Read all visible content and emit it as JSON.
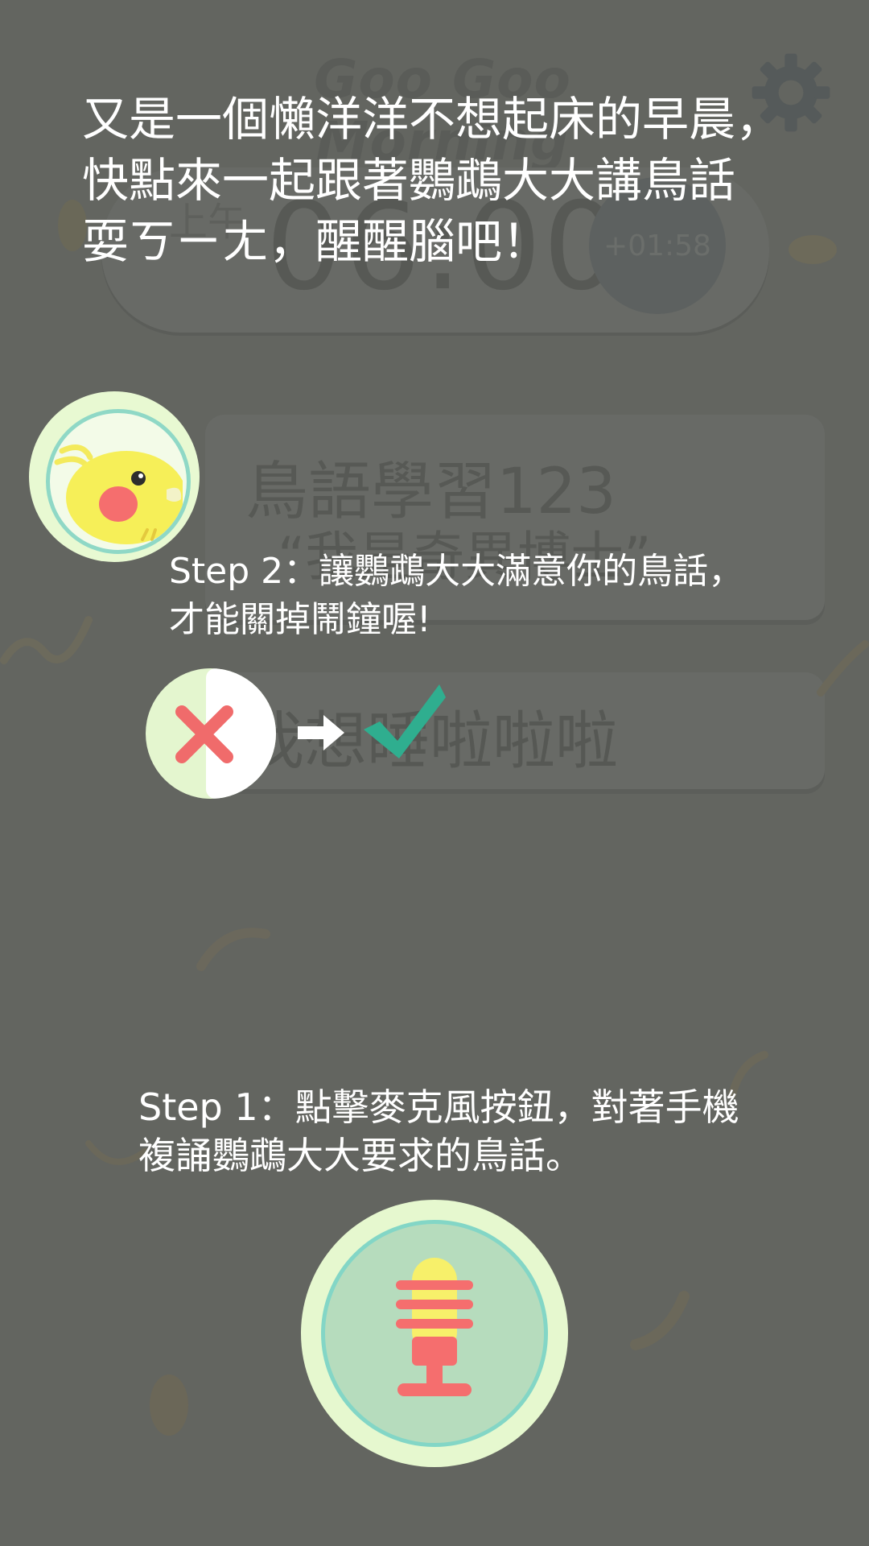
{
  "background_app": {
    "title": "Goo Goo Morning",
    "alarm": {
      "ampm": "上午",
      "time": "06:00",
      "countdown": "+01:58"
    },
    "phrase_card": {
      "title": "鳥語學習123",
      "subtitle": "“我是奇異博士”"
    },
    "answer_card": {
      "text": "我想睡啦啦啦"
    }
  },
  "overlay": {
    "intro_lines": [
      "又是一個懶洋洋不想起床的早晨，",
      "快點來一起跟著鸚鵡大大講鳥話",
      "耍ㄎㄧㄤ，醒醒腦吧！"
    ],
    "step2_lines": [
      "Step 2：讓鸚鵡大大滿意你的鳥話，",
      "才能關掉鬧鐘喔!"
    ],
    "step1_lines": [
      "Step 1：點擊麥克風按鈕，對著手機",
      "複誦鸚鵡大大要求的鳥話。"
    ]
  },
  "icons": {
    "settings": "gear-icon",
    "avatar": "parrot-icon",
    "wrong": "x-mark-icon",
    "arrow": "right-arrow-icon",
    "correct": "check-icon",
    "record": "microphone-icon"
  },
  "colors": {
    "overlay_bg": "#636560",
    "accent_green": "#2fae8f",
    "wrong_red": "#f06b6b",
    "mic_yellow": "#f7f06a",
    "mic_red": "#f56e6e",
    "ring_teal": "#83d6c6"
  }
}
